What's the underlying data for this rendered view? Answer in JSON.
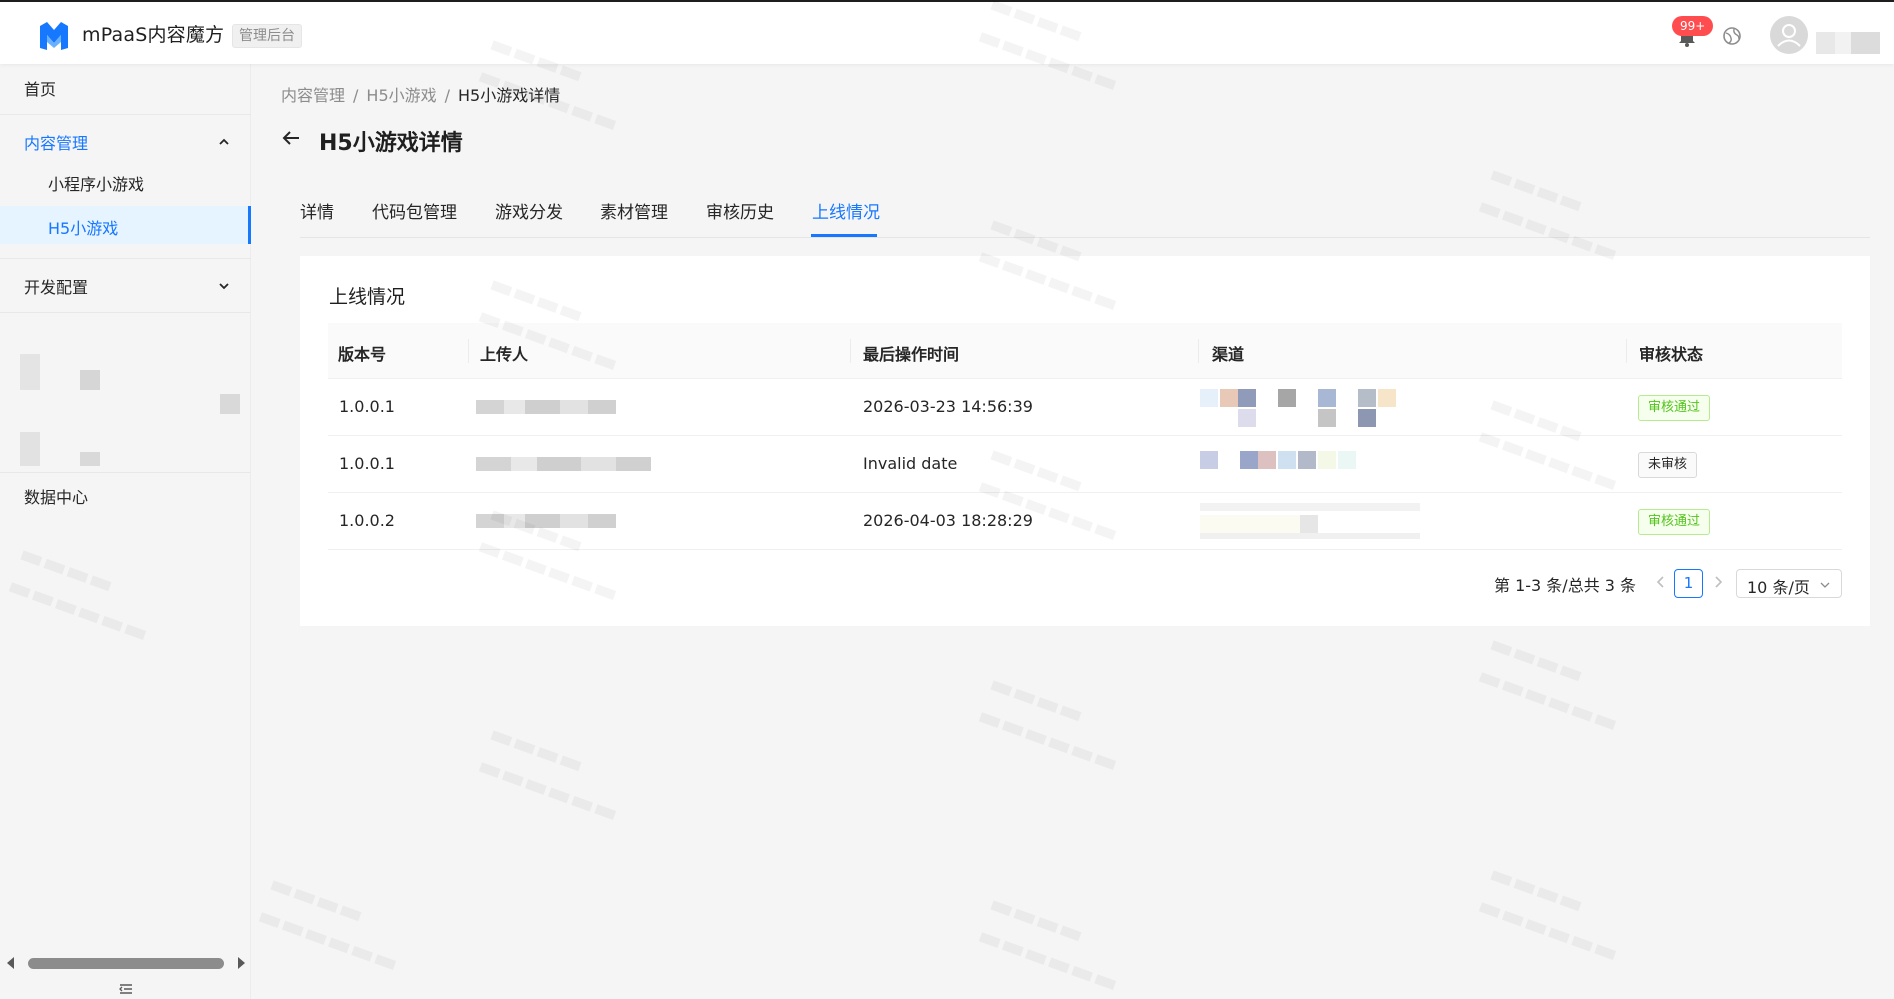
{
  "header": {
    "brand": "mPaaS内容魔方",
    "admin_tag": "管理后台",
    "notification_badge": "99+"
  },
  "sidebar": {
    "home": "首页",
    "content_mgmt": "内容管理",
    "sub_mini_games": "小程序小游戏",
    "sub_h5_games": "H5小游戏",
    "dev_config": "开发配置",
    "data_center": "数据中心"
  },
  "breadcrumb": {
    "level1": "内容管理",
    "level2": "H5小游戏",
    "current": "H5小游戏详情",
    "separator": "/"
  },
  "page": {
    "title": "H5小游戏详情"
  },
  "tabs": [
    {
      "label": "详情"
    },
    {
      "label": "代码包管理"
    },
    {
      "label": "游戏分发"
    },
    {
      "label": "素材管理"
    },
    {
      "label": "审核历史"
    },
    {
      "label": "上线情况",
      "active": true
    }
  ],
  "card": {
    "title": "上线情况"
  },
  "table": {
    "columns": [
      "版本号",
      "上传人",
      "最后操作时间",
      "渠道",
      "审核状态"
    ],
    "rows": [
      {
        "version": "1.0.0.1",
        "time": "2026-03-23 14:56:39",
        "status": "审核通过",
        "status_type": "success"
      },
      {
        "version": "1.0.0.1",
        "time": "Invalid date",
        "status": "未审核",
        "status_type": "default"
      },
      {
        "version": "1.0.0.2",
        "time": "2026-04-03 18:28:29",
        "status": "审核通过",
        "status_type": "success"
      }
    ]
  },
  "pagination": {
    "total_text": "第 1-3 条/总共 3 条",
    "current_page": "1",
    "page_size": "10 条/页"
  },
  "colors": {
    "primary": "#1677ff",
    "success": "#52c41a",
    "badge": "#ff4d4f"
  }
}
